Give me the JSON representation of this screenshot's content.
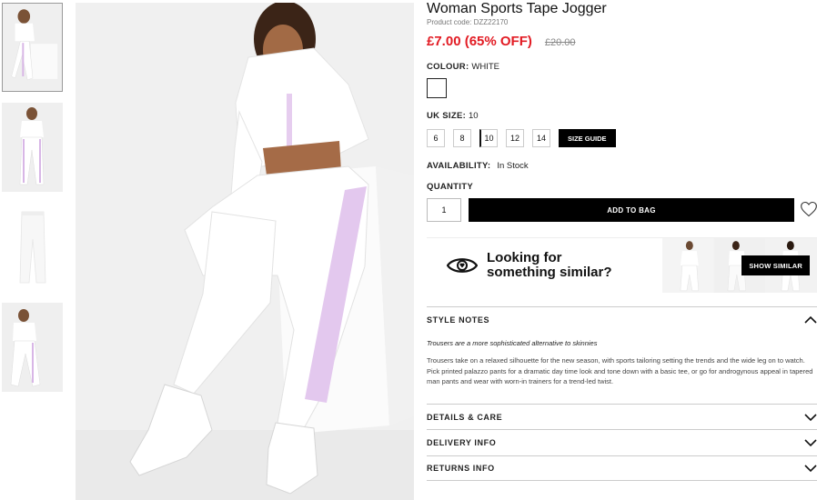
{
  "product": {
    "title": "Woman Sports Tape Jogger",
    "code": "Product code: DZZ22170",
    "price": "£7.00 (65% OFF)",
    "was_price": "£20.00"
  },
  "colour": {
    "label": "COLOUR:",
    "value": "WHITE",
    "swatch_color": "#ffffff"
  },
  "size": {
    "label": "UK SIZE:",
    "value": "10",
    "options": [
      "6",
      "8",
      "10",
      "12",
      "14"
    ],
    "selected": "10",
    "guide_label": "SIZE GUIDE"
  },
  "availability": {
    "label": "AVAILABILITY:",
    "value": "In Stock"
  },
  "quantity": {
    "label": "QUANTITY",
    "value": "1"
  },
  "add_to_bag": "ADD TO BAG",
  "similar": {
    "text_line1": "Looking for",
    "text_line2": "something similar?",
    "button": "SHOW SIMILAR"
  },
  "style_notes": {
    "label": "STYLE NOTES",
    "lead": "Trousers are a more sophisticated alternative to skinnies",
    "body": "Trousers take on a relaxed silhouette for the new season, with sports tailoring setting the trends and the wide leg on to watch. Pick printed palazzo pants for a dramatic day time look and tone down with a basic tee, or go for androgynous appeal in tapered man pants and wear with worn-in trainers for a trend-led twist."
  },
  "accordions": {
    "details": "DETAILS & CARE",
    "delivery": "DELIVERY INFO",
    "returns": "RETURNS INFO"
  },
  "icons": [
    "heart-icon",
    "eye-icon",
    "chevron-up-icon",
    "chevron-down-icon"
  ],
  "colors": {
    "sale_red": "#e21b23",
    "button_black": "#000000",
    "tape_lilac": "#e3c8ee"
  }
}
